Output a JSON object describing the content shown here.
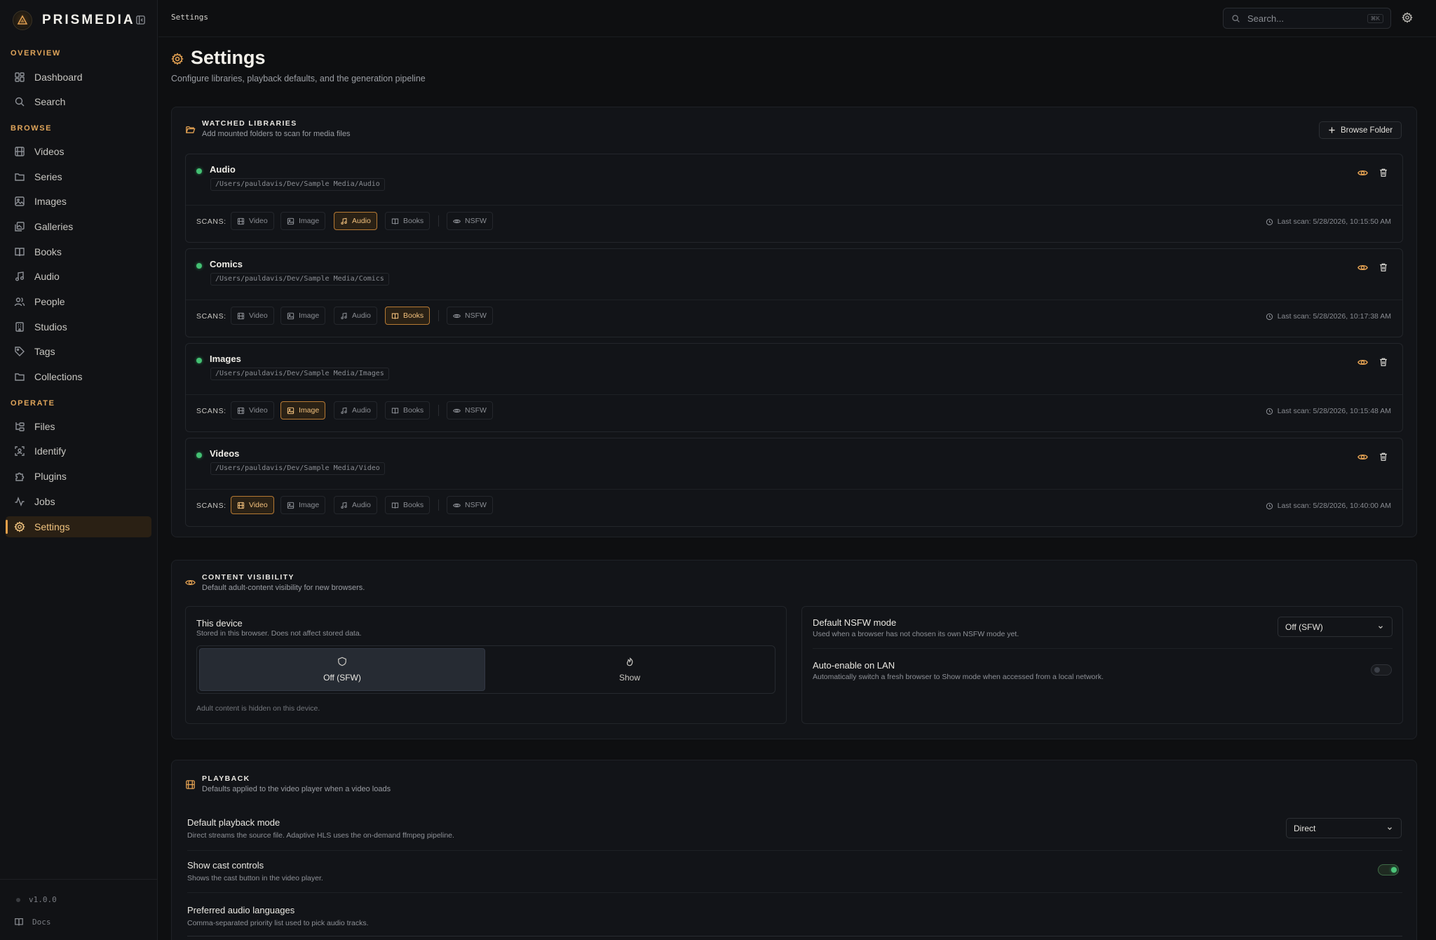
{
  "app": {
    "name": "PRISMEDIA",
    "version": "v1.0.0",
    "docs_label": "Docs"
  },
  "sidebar": {
    "sections": [
      {
        "label": "OVERVIEW"
      },
      {
        "label": "BROWSE"
      },
      {
        "label": "OPERATE"
      }
    ],
    "items": [
      {
        "label": "Dashboard",
        "icon": "dashboard-icon"
      },
      {
        "label": "Search",
        "icon": "search-icon"
      },
      {
        "label": "Videos",
        "icon": "film-icon"
      },
      {
        "label": "Series",
        "icon": "folder-icon"
      },
      {
        "label": "Images",
        "icon": "image-icon"
      },
      {
        "label": "Galleries",
        "icon": "gallery-icon"
      },
      {
        "label": "Books",
        "icon": "book-icon"
      },
      {
        "label": "Audio",
        "icon": "music-icon"
      },
      {
        "label": "People",
        "icon": "people-icon"
      },
      {
        "label": "Studios",
        "icon": "building-icon"
      },
      {
        "label": "Tags",
        "icon": "tag-icon"
      },
      {
        "label": "Collections",
        "icon": "folder-icon"
      },
      {
        "label": "Files",
        "icon": "files-icon"
      },
      {
        "label": "Identify",
        "icon": "scan-face-icon"
      },
      {
        "label": "Plugins",
        "icon": "puzzle-icon"
      },
      {
        "label": "Jobs",
        "icon": "activity-icon"
      },
      {
        "label": "Settings",
        "icon": "gear-icon",
        "active": true
      }
    ]
  },
  "topbar": {
    "breadcrumb": "Settings",
    "search_placeholder": "Search...",
    "search_shortcut": "⌘K"
  },
  "page": {
    "title": "Settings",
    "subtitle": "Configure libraries, playback defaults, and the generation pipeline"
  },
  "libraries_panel": {
    "title": "WATCHED LIBRARIES",
    "description": "Add mounted folders to scan for media files",
    "browse_label": "Browse Folder",
    "scans_label": "SCANS:",
    "chip_labels": {
      "video": "Video",
      "image": "Image",
      "audio": "Audio",
      "books": "Books",
      "nsfw": "NSFW"
    },
    "libraries": [
      {
        "name": "Audio",
        "path": "/Users/pauldavis/Dev/Sample Media/Audio",
        "active_chip": "audio",
        "last_scan": "Last scan: 5/28/2026, 10:15:50 AM"
      },
      {
        "name": "Comics",
        "path": "/Users/pauldavis/Dev/Sample Media/Comics",
        "active_chip": "books",
        "last_scan": "Last scan: 5/28/2026, 10:17:38 AM"
      },
      {
        "name": "Images",
        "path": "/Users/pauldavis/Dev/Sample Media/Images",
        "active_chip": "image",
        "last_scan": "Last scan: 5/28/2026, 10:15:48 AM"
      },
      {
        "name": "Videos",
        "path": "/Users/pauldavis/Dev/Sample Media/Video",
        "active_chip": "video",
        "last_scan": "Last scan: 5/28/2026, 10:40:00 AM"
      }
    ]
  },
  "visibility_panel": {
    "title": "CONTENT VISIBILITY",
    "description": "Default adult-content visibility for new browsers.",
    "device": {
      "title": "This device",
      "description": "Stored in this browser. Does not affect stored data.",
      "option_off": "Off (SFW)",
      "option_show": "Show",
      "selected": "off",
      "note": "Adult content is hidden on this device."
    },
    "default_mode": {
      "title": "Default NSFW mode",
      "description": "Used when a browser has not chosen its own NSFW mode yet.",
      "value": "Off (SFW)"
    },
    "auto_lan": {
      "title": "Auto-enable on LAN",
      "description": "Automatically switch a fresh browser to Show mode when accessed from a local network.",
      "enabled": false
    }
  },
  "playback_panel": {
    "title": "PLAYBACK",
    "description": "Defaults applied to the video player when a video loads",
    "mode": {
      "title": "Default playback mode",
      "description": "Direct streams the source file. Adaptive HLS uses the on-demand ffmpeg pipeline.",
      "value": "Direct"
    },
    "cast": {
      "title": "Show cast controls",
      "description": "Shows the cast button in the video player.",
      "enabled": true
    },
    "audio_langs": {
      "title": "Preferred audio languages",
      "description": "Comma-separated priority list used to pick audio tracks."
    }
  },
  "colors": {
    "accent": "#e3a152",
    "status_ok": "#44c073",
    "background": "#0e0f11"
  }
}
